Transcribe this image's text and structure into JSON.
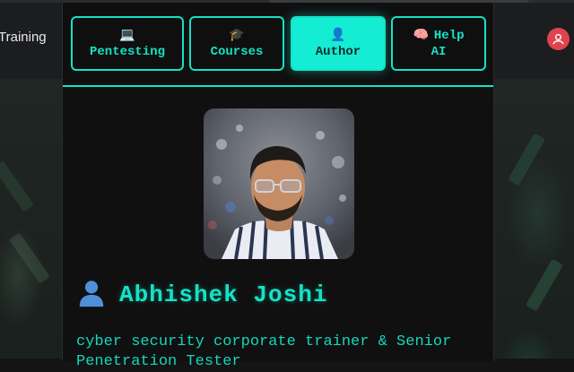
{
  "background": {
    "brand_text": "Training",
    "icons": {
      "account": "user-circle-icon"
    }
  },
  "menu": {
    "tabs": [
      {
        "icon": "💻",
        "icon_name": "laptop-icon",
        "label": "Pentesting"
      },
      {
        "icon": "🎓",
        "icon_name": "graduation-cap-icon",
        "label": "Courses"
      },
      {
        "icon": "👤",
        "icon_name": "person-icon",
        "label": "Author"
      },
      {
        "icon": "🧠",
        "icon_name": "brain-icon",
        "label_line1": "Help",
        "label_line2": "AI"
      }
    ],
    "active_tab": "Author"
  },
  "author": {
    "name": "Abhishek Joshi",
    "name_icon": "person-icon",
    "description": "cyber security corporate trainer & Senior Penetration Tester"
  },
  "colors": {
    "accent": "#14e3c5",
    "active_tab_bg": "#14ecd3",
    "panel_bg": "#101010",
    "account_icon_bg": "#e0434f"
  }
}
